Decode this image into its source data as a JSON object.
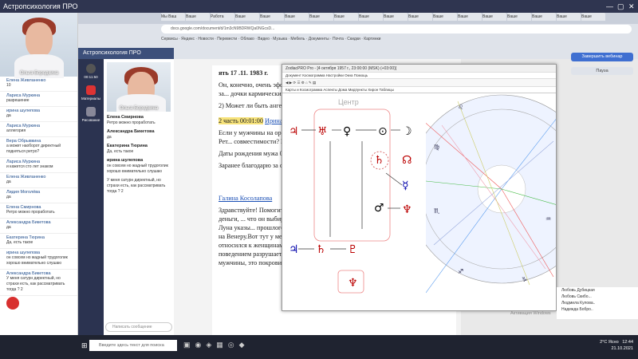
{
  "window": {
    "title": "Астропсихология ПРО"
  },
  "outer_chat": {
    "video_name": "Ольга Бородкина",
    "messages": [
      {
        "name": "Елена Живланенко",
        "text": "10"
      },
      {
        "name": "Лариса Муркина",
        "text": "разрешение"
      },
      {
        "name": "ирина шулепова",
        "text": "да"
      },
      {
        "name": "Лариса Муркина",
        "text": "аллегория"
      },
      {
        "name": "Вера Обрывкина",
        "text": "а может наоборот директный подняться ретро?"
      },
      {
        "name": "Лариса Муркина",
        "text": "и кажется сто лет знаком"
      },
      {
        "name": "Елена Живланенко",
        "text": "да"
      },
      {
        "name": "Лидия Моголёва",
        "text": "да"
      },
      {
        "name": "Елена Смирнова",
        "text": "Ретро можно проработать"
      },
      {
        "name": "Александра Бикетова",
        "text": "да"
      },
      {
        "name": "Екатерина Тюрина",
        "text": "Да, есть такое"
      },
      {
        "name": "ирина шулепова",
        "text": "он совсем но жадный трудоголик хорошо внимательно слушаю"
      },
      {
        "name": "Александра Бикетова",
        "text": "У меня сатурн директный, но страхи есть, как рассматривать тогда ? 2"
      }
    ]
  },
  "browser": {
    "url": "docs.google.com/document/d/1m3cN9BDRWQa0NGcsD...",
    "tabs": [
      "Мы Ваш",
      "Ваше",
      "Работа",
      "Ваше",
      "Ваше",
      "Ваше",
      "Ваше",
      "Ваше",
      "Ваше",
      "Ваше",
      "Ваше",
      "Ваше",
      "Ваше",
      "Ваше",
      "Ваше",
      "Ваше",
      "Ваше",
      "Ваше"
    ],
    "bookmarks": "Сервисы · Яндекс · Новости · Перевести · Облако · Видео · Музыка · Мебель · Документы · Почта · Скидки · Картинки"
  },
  "app": {
    "header": "Астропсихология ПРО",
    "timer": "00:11:50",
    "leftbar": [
      "Материалы",
      "Рисование"
    ],
    "chat_video_name": "Ольга Бородкина",
    "messages": [
      {
        "name": "Елена Смирнова",
        "text": "Ретро можно проработать"
      },
      {
        "name": "Александра Бикетова",
        "text": "да"
      },
      {
        "name": "Екатерина Тюрина",
        "text": "Да, есть такое"
      },
      {
        "name": "ирина шулепова",
        "text": "он совсем но жадный трудоголик хорошо внимательно слушаю"
      },
      {
        "name": "",
        "text": "У меня сатурн директный, но страхи есть, как рассматривать тогда ? 2"
      }
    ],
    "input_placeholder": "Написать сообщение",
    "finish_button": "Завершить вебинар",
    "pause_button": "Пауза"
  },
  "document": {
    "heading": "ять 17 .11. 1983 г.",
    "p1": "Он, конечно, очень эффектный мужчина... походы все вместе. Я, пока ничего не за... дочки кармический брак. Хотя по креста...",
    "p2": "2) Может ли быть ангелом хранителем с...",
    "part_label": "2 часть 00:01:00",
    "part_author": "Ирина Шулепова",
    "p3": "Если у мужчины на орбите Венеры директ... у женщины в центре - Ретро Плутон, Рет... совместимости? Планеты противополо...",
    "p4": "Даты рождения мужа 08.06.1958, жены - ...",
    "p5": "Заранее благодарю за ответ.",
    "author2": "Галина Косолапова",
    "p6": "Здравствуйте! Помогите мне пожалуйста... все у него благополучно, работа, деньги, ... что он выбирает красивых женщин, дома... ли я понимаю, у него чёрная Луна указы... прошлого, без разрушителя. Луна делает Плутон ретро и указывает на Венеру.Вот тут у меня вопрос, это значит, что он в прошлой жизни плохо относился к женщинам и теперь женщины его отвергают или сейчас своим поведением разрушает отношения? Вообще Плутон на орбите Марса хорошо для мужчины, это покровительство. Подскажите"
  },
  "astro": {
    "title": "ZodiacPRO Pro - [4 октября 1957 г., 23:00:00 (MSK) (+03:00)]",
    "menu": "Документ  Космограмма  Настройки  Окна  Помощь",
    "tabs": "Карты и Космограмма   Аспекты   Дома   Мидпункты   Хирон   Таблицы",
    "center_label": "Центр"
  },
  "right_panel": {
    "items": [
      "Любовь Дубицкая",
      "Любовь Скибо...",
      "Людмила Кулова..",
      "Надежда Бобро.."
    ],
    "watermark": "Активация Windows"
  },
  "taskbar": {
    "search_placeholder": "Введите здесь текст для поиска",
    "temp": "2°C Ясно",
    "time": "12:44",
    "date": "21.10.2021"
  }
}
